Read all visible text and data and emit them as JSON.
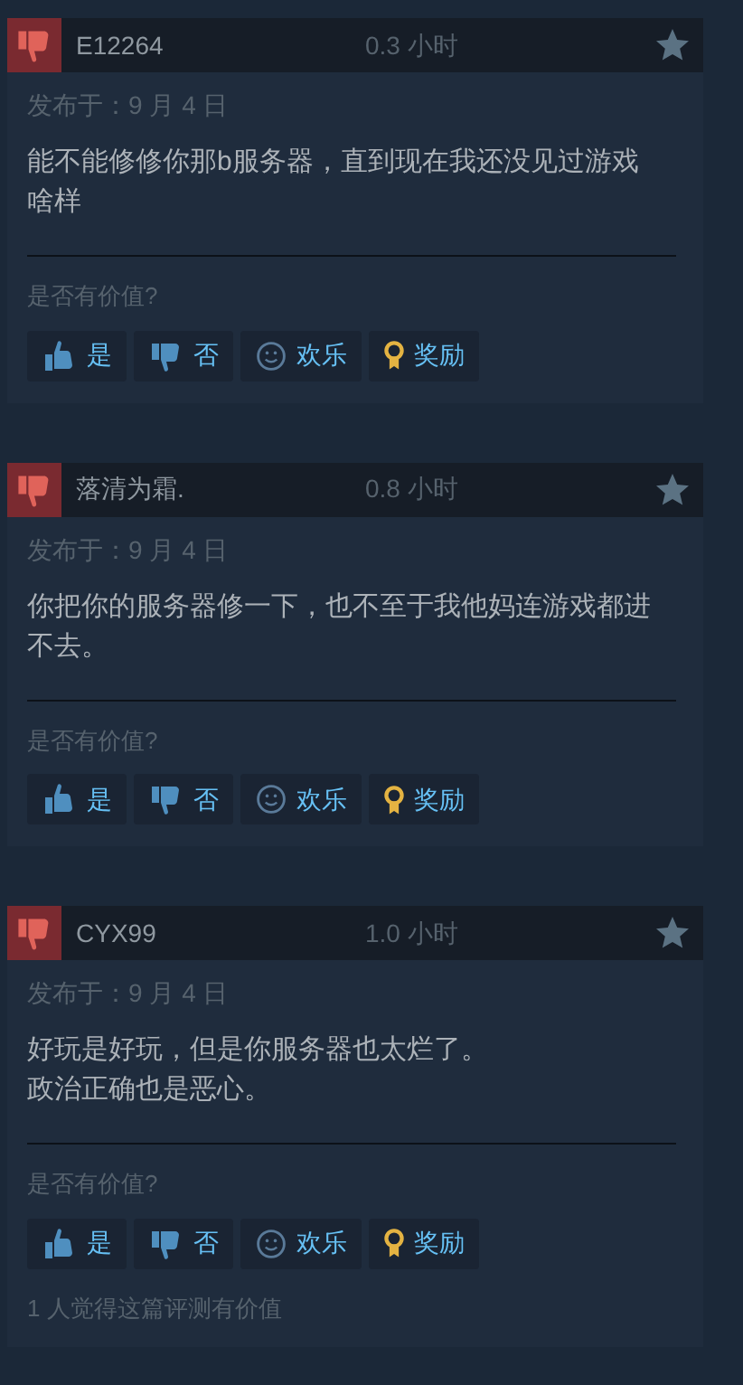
{
  "reviews": [
    {
      "recommended": false,
      "username": "E12264",
      "hours": "0.3 小时",
      "posted": "发布于：9 月 4 日",
      "text": "能不能修修你那b服务器，直到现在我还没见过游戏啥样",
      "helpful_prompt": "是否有价值?",
      "buttons": [
        {
          "kind": "yes",
          "label": "是"
        },
        {
          "kind": "no",
          "label": "否"
        },
        {
          "kind": "funny",
          "label": "欢乐"
        },
        {
          "kind": "award",
          "label": "奖励"
        }
      ]
    },
    {
      "recommended": false,
      "username": "落清为霜.",
      "hours": "0.8 小时",
      "posted": "发布于：9 月 4 日",
      "text": "你把你的服务器修一下，也不至于我他妈连游戏都进不去。",
      "helpful_prompt": "是否有价值?",
      "buttons": [
        {
          "kind": "yes",
          "label": "是"
        },
        {
          "kind": "no",
          "label": "否"
        },
        {
          "kind": "funny",
          "label": "欢乐"
        },
        {
          "kind": "award",
          "label": "奖励"
        }
      ]
    },
    {
      "recommended": false,
      "username": "CYX99",
      "hours": "1.0 小时",
      "posted": "发布于：9 月 4 日",
      "text": "好玩是好玩，但是你服务器也太烂了。",
      "text_2": "政治正确也是恶心。",
      "helpful_prompt": "是否有价值?",
      "buttons": [
        {
          "kind": "yes",
          "label": "是"
        },
        {
          "kind": "no",
          "label": "否"
        },
        {
          "kind": "funny",
          "label": "欢乐"
        },
        {
          "kind": "award",
          "label": "奖励"
        }
      ],
      "helpful_count": "1 人觉得这篇评测有价值"
    }
  ]
}
